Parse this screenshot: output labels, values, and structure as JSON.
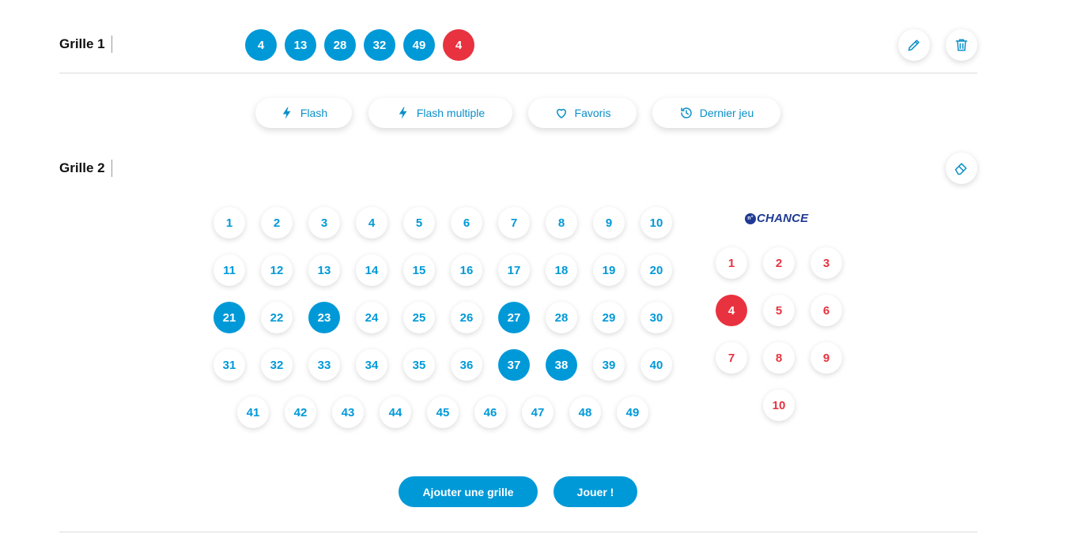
{
  "grille1": {
    "title": "Grille 1",
    "numbers": [
      "4",
      "13",
      "28",
      "32",
      "49"
    ],
    "chance": "4"
  },
  "quick_actions": [
    {
      "label": "Flash",
      "icon": "bolt-icon"
    },
    {
      "label": "Flash multiple",
      "icon": "bolt-icon"
    },
    {
      "label": "Favoris",
      "icon": "heart-icon"
    },
    {
      "label": "Dernier jeu",
      "icon": "history-icon"
    }
  ],
  "grille2": {
    "title": "Grille 2",
    "main_numbers": [
      "1",
      "2",
      "3",
      "4",
      "5",
      "6",
      "7",
      "8",
      "9",
      "10",
      "11",
      "12",
      "13",
      "14",
      "15",
      "16",
      "17",
      "18",
      "19",
      "20",
      "21",
      "22",
      "23",
      "24",
      "25",
      "26",
      "27",
      "28",
      "29",
      "30",
      "31",
      "32",
      "33",
      "34",
      "35",
      "36",
      "37",
      "38",
      "39",
      "40",
      "41",
      "42",
      "43",
      "44",
      "45",
      "46",
      "47",
      "48",
      "49"
    ],
    "selected_main": [
      "21",
      "23",
      "27",
      "37",
      "38"
    ],
    "chance_logo_text": "CHANCE",
    "chance_logo_badge": "n°",
    "chance_numbers": [
      "1",
      "2",
      "3",
      "4",
      "5",
      "6",
      "7",
      "8",
      "9",
      "10"
    ],
    "selected_chance": [
      "4"
    ]
  },
  "buttons": {
    "add_grid": "Ajouter une grille",
    "play": "Jouer !"
  },
  "colors": {
    "blue": "#0099d8",
    "red": "#e8323f",
    "logo": "#1f3a93"
  }
}
